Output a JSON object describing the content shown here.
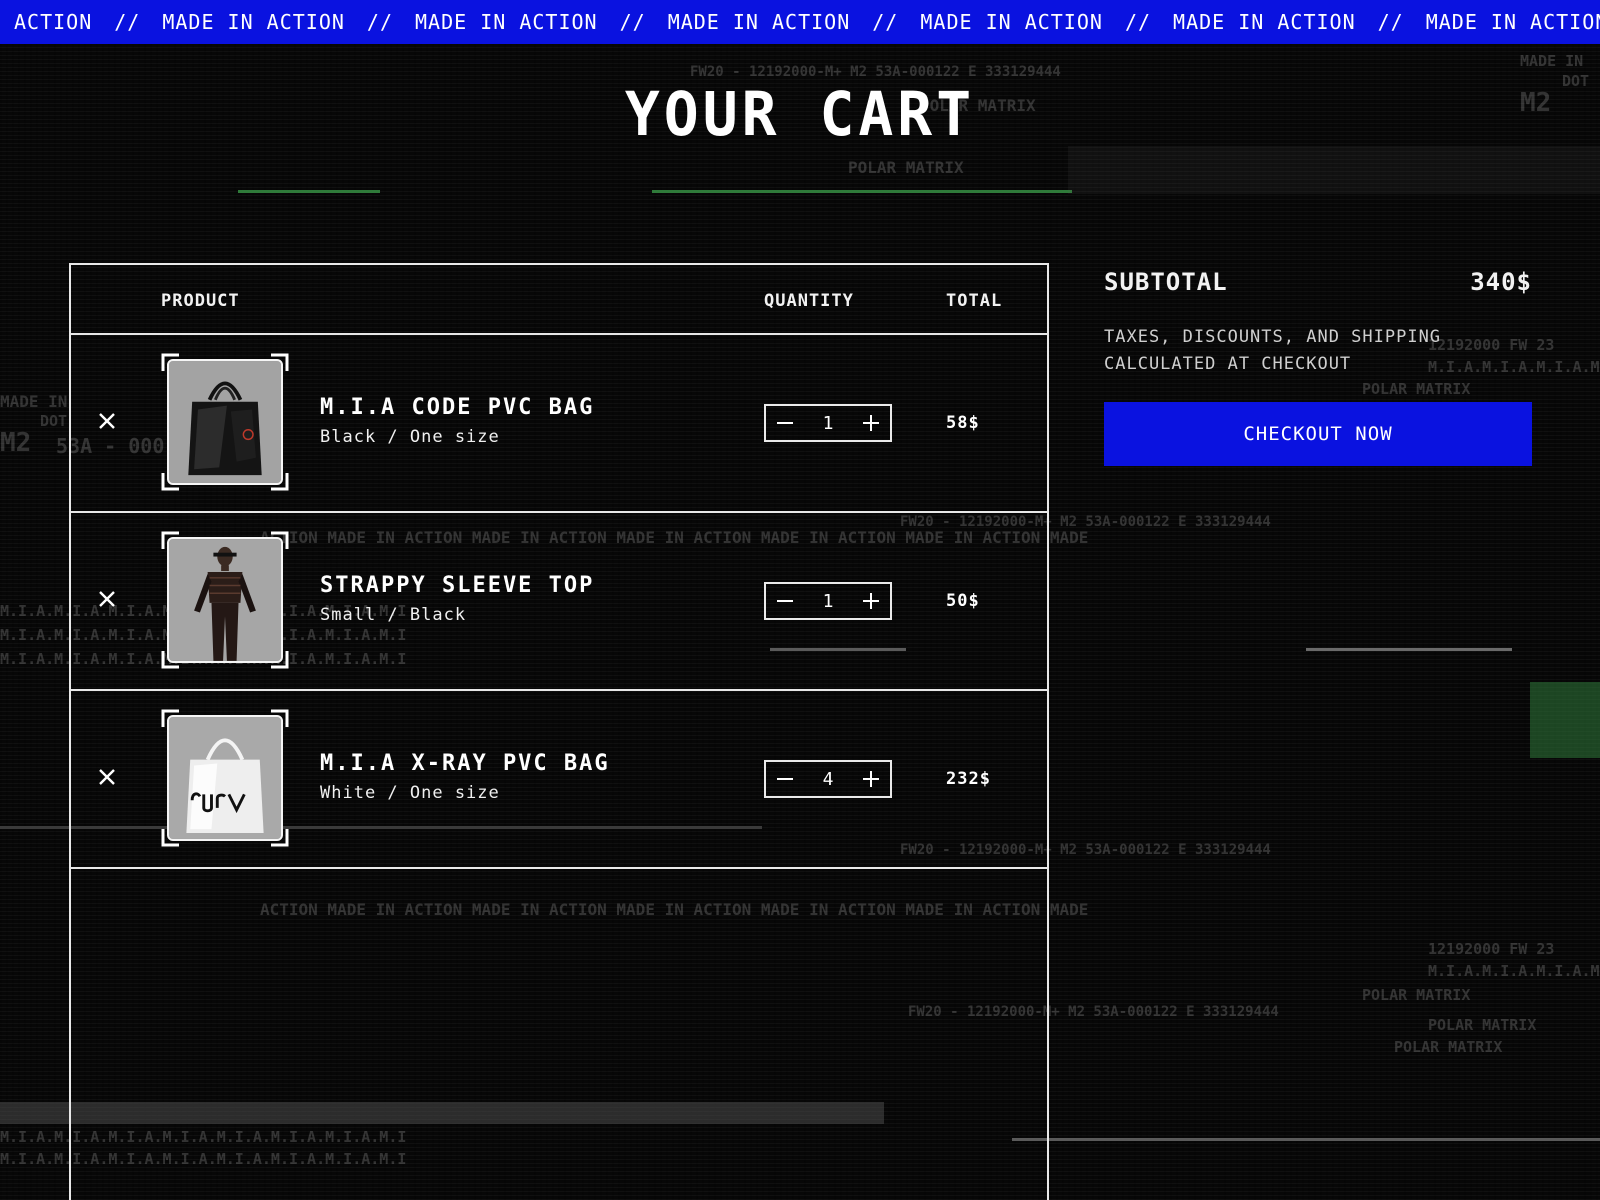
{
  "colors": {
    "accent": "#0a12e0",
    "ticker_bg": "#0a12e0",
    "background": "#070707",
    "border": "#e8e8e8",
    "decor_green": "#2f7a3a"
  },
  "ticker": {
    "segments": [
      "ACTION",
      "MADE IN ACTION",
      "MADE IN ACTION",
      "MADE IN ACTION",
      "MADE IN ACTION",
      "MADE IN ACTION",
      "MADE IN ACTION"
    ],
    "separator": "//"
  },
  "page": {
    "title": "YOUR CART"
  },
  "cart": {
    "headers": {
      "product": "PRODUCT",
      "quantity": "QUANTITY",
      "total": "TOTAL"
    },
    "items": [
      {
        "name": "M.I.A CODE PVC BAG",
        "variant": "Black / One size",
        "quantity": "1",
        "total": "58$",
        "image_icon": "black-tote-bag-image"
      },
      {
        "name": "STRAPPY SLEEVE TOP",
        "variant": "Small / Black",
        "quantity": "1",
        "total": "50$",
        "image_icon": "model-wearing-top-image"
      },
      {
        "name": "M.I.A X-RAY PVC BAG",
        "variant": "White / One size",
        "quantity": "4",
        "total": "232$",
        "image_icon": "clear-pvc-bag-image"
      }
    ],
    "icons": {
      "remove": "close-icon",
      "decrease": "minus-icon",
      "increase": "plus-icon"
    }
  },
  "summary": {
    "subtotal_label": "SUBTOTAL",
    "subtotal_value": "340$",
    "tax_note": "TAXES, DISCOUNTS, AND SHIPPING CALCULATED AT CHECKOUT",
    "checkout_label": "CHECKOUT NOW"
  },
  "decor": {
    "polar_matrix": "POLAR MATRIX",
    "made_in": "MADE IN",
    "m2": "M2",
    "mia": "M.I.A.M.I.A.M.I.A.M.I.A.M.I.A.M.I.A.M.I.A.M.I",
    "serial": "FW20 - 12192000-M+ M2 53A-000122 E 333129444",
    "action_strip": "ACTION MADE IN ACTION MADE IN ACTION MADE IN ACTION MADE IN ACTION MADE IN ACTION MADE",
    "code_a": "12192000 FW 23",
    "code_b": "53A - 000",
    "dot": "DOT"
  }
}
